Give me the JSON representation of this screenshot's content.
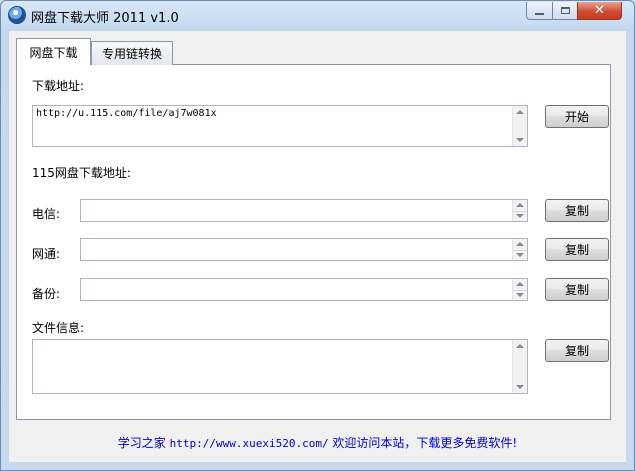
{
  "window": {
    "title": "网盘下载大师 2011 v1.0"
  },
  "tabs": [
    {
      "label": "网盘下载",
      "active": true
    },
    {
      "label": "专用链转换",
      "active": false
    }
  ],
  "download": {
    "label": "下载地址:",
    "url_value": "http://u.115.com/file/aj7w081x",
    "start_button": "开始"
  },
  "section_115": {
    "label": "115网盘下载地址:"
  },
  "links": [
    {
      "label": "电信:",
      "value": "",
      "copy_button": "复制"
    },
    {
      "label": "网通:",
      "value": "",
      "copy_button": "复制"
    },
    {
      "label": "备份:",
      "value": "",
      "copy_button": "复制"
    }
  ],
  "file_info": {
    "label": "文件信息:",
    "value": "",
    "copy_button": "复制"
  },
  "footer": {
    "site_name": "学习之家",
    "url": "http://www.xuexi520.com/",
    "message": "欢迎访问本站，下载更多免费软件!"
  },
  "colors": {
    "footer_text": "#0000cc",
    "close_button": "#c6391f"
  }
}
